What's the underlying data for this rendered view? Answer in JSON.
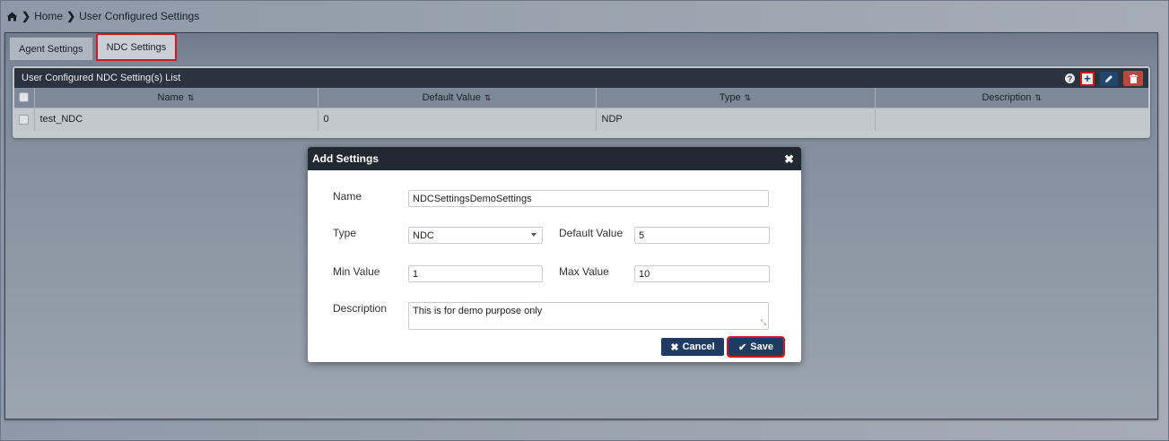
{
  "breadcrumb": {
    "home_label": "Home",
    "current_label": "User Configured Settings"
  },
  "tabs": [
    {
      "label": "Agent Settings",
      "active": false
    },
    {
      "label": "NDC Settings",
      "active": true
    }
  ],
  "grid": {
    "title": "User Configured NDC Setting(s) List",
    "columns": [
      "Name",
      "Default Value",
      "Type",
      "Description"
    ],
    "rows": [
      {
        "name": "test_NDC",
        "default_value": "0",
        "type": "NDP",
        "description": ""
      }
    ],
    "toolbar": {
      "help_icon": "question-circle-icon",
      "add_icon": "plus-icon",
      "edit_icon": "pencil-icon",
      "delete_icon": "trash-icon"
    }
  },
  "modal": {
    "title": "Add Settings",
    "close_icon": "close-icon",
    "name_label": "Name",
    "name_value": "NDCSettingsDemoSettings",
    "type_label": "Type",
    "type_value": "NDC",
    "default_label": "Default Value",
    "default_value": "5",
    "min_label": "Min Value",
    "min_value": "1",
    "max_label": "Max Value",
    "max_value": "10",
    "description_label": "Description",
    "description_value": "This is for demo purpose only",
    "cancel_label": "Cancel",
    "save_label": "Save"
  },
  "colors": {
    "accent_highlight": "#d0181f",
    "primary_button": "#1f3b62",
    "dark_header": "#222831",
    "delete_button": "#b7493f"
  }
}
